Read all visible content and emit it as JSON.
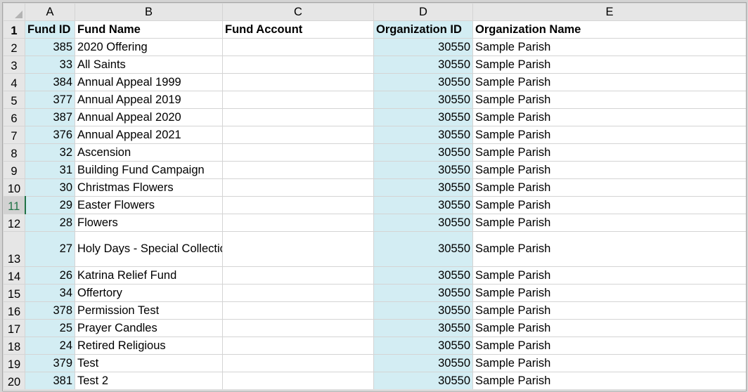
{
  "columns": [
    "A",
    "B",
    "C",
    "D",
    "E"
  ],
  "header_row": {
    "row": "1",
    "fund_id": "Fund ID",
    "fund_name": "Fund Name",
    "fund_account": "Fund Account",
    "org_id": "Organization ID",
    "org_name": "Organization Name"
  },
  "rows": [
    {
      "row": "2",
      "fund_id": "385",
      "fund_name": "2020 Offering",
      "fund_account": "",
      "org_id": "30550",
      "org_name": "Sample Parish"
    },
    {
      "row": "3",
      "fund_id": "33",
      "fund_name": "All Saints",
      "fund_account": "",
      "org_id": "30550",
      "org_name": "Sample Parish"
    },
    {
      "row": "4",
      "fund_id": "384",
      "fund_name": "Annual Appeal 1999",
      "fund_account": "",
      "org_id": "30550",
      "org_name": "Sample Parish"
    },
    {
      "row": "5",
      "fund_id": "377",
      "fund_name": "Annual Appeal 2019",
      "fund_account": "",
      "org_id": "30550",
      "org_name": "Sample Parish"
    },
    {
      "row": "6",
      "fund_id": "387",
      "fund_name": "Annual Appeal 2020",
      "fund_account": "",
      "org_id": "30550",
      "org_name": "Sample Parish"
    },
    {
      "row": "7",
      "fund_id": "376",
      "fund_name": "Annual Appeal 2021",
      "fund_account": "",
      "org_id": "30550",
      "org_name": "Sample Parish"
    },
    {
      "row": "8",
      "fund_id": "32",
      "fund_name": "Ascension",
      "fund_account": "",
      "org_id": "30550",
      "org_name": "Sample Parish"
    },
    {
      "row": "9",
      "fund_id": "31",
      "fund_name": "Building Fund Campaign",
      "fund_account": "",
      "org_id": "30550",
      "org_name": "Sample Parish"
    },
    {
      "row": "10",
      "fund_id": "30",
      "fund_name": "Christmas Flowers",
      "fund_account": "",
      "org_id": "30550",
      "org_name": "Sample Parish"
    },
    {
      "row": "11",
      "fund_id": "29",
      "fund_name": "Easter Flowers",
      "fund_account": "",
      "org_id": "30550",
      "org_name": "Sample Parish"
    },
    {
      "row": "12",
      "fund_id": "28",
      "fund_name": "Flowers",
      "fund_account": "",
      "org_id": "30550",
      "org_name": "Sample Parish"
    },
    {
      "row": "13",
      "fund_id": "27",
      "fund_name": "Holy Days - Special Collections",
      "fund_account": "",
      "org_id": "30550",
      "org_name": "Sample Parish"
    },
    {
      "row": "14",
      "fund_id": "26",
      "fund_name": "Katrina Relief Fund",
      "fund_account": "",
      "org_id": "30550",
      "org_name": "Sample Parish"
    },
    {
      "row": "15",
      "fund_id": "34",
      "fund_name": "Offertory",
      "fund_account": "",
      "org_id": "30550",
      "org_name": "Sample Parish"
    },
    {
      "row": "16",
      "fund_id": "378",
      "fund_name": "Permission Test",
      "fund_account": "",
      "org_id": "30550",
      "org_name": "Sample Parish"
    },
    {
      "row": "17",
      "fund_id": "25",
      "fund_name": "Prayer Candles",
      "fund_account": "",
      "org_id": "30550",
      "org_name": "Sample Parish"
    },
    {
      "row": "18",
      "fund_id": "24",
      "fund_name": "Retired Religious",
      "fund_account": "",
      "org_id": "30550",
      "org_name": "Sample Parish"
    },
    {
      "row": "19",
      "fund_id": "379",
      "fund_name": "Test",
      "fund_account": "",
      "org_id": "30550",
      "org_name": "Sample Parish"
    },
    {
      "row": "20",
      "fund_id": "381",
      "fund_name": "Test 2",
      "fund_account": "",
      "org_id": "30550",
      "org_name": "Sample Parish"
    }
  ],
  "active_row": "11",
  "selection_color": "#d3edf3",
  "active_accent": "#217346"
}
